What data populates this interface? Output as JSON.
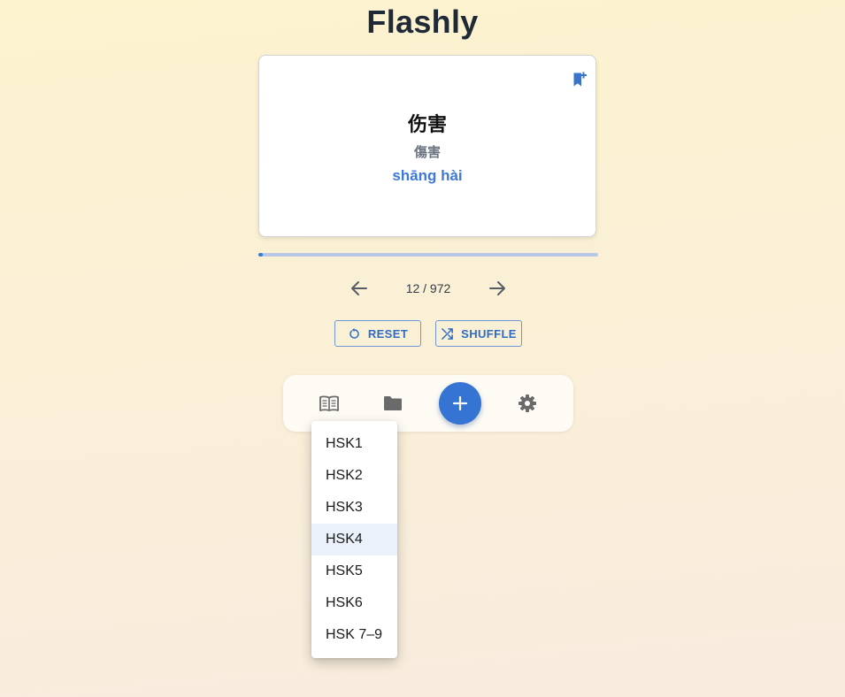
{
  "app": {
    "title": "Flashly"
  },
  "card": {
    "hanzi": "伤害",
    "traditional": "傷害",
    "pinyin": "shāng hài",
    "bookmark_icon": "bookmark-add-icon"
  },
  "progress": {
    "current": 12,
    "total": 972,
    "fraction": 0.0123
  },
  "navigation": {
    "counter": "12 / 972",
    "prev_icon": "arrow-left-icon",
    "next_icon": "arrow-right-icon"
  },
  "actions": {
    "reset_label": "RESET",
    "reset_icon": "reset-icon",
    "shuffle_label": "SHUFFLE",
    "shuffle_icon": "shuffle-icon"
  },
  "toolbar": {
    "items": [
      {
        "icon": "book-icon"
      },
      {
        "icon": "folder-icon"
      },
      {
        "icon": "plus-icon"
      },
      {
        "icon": "gear-icon"
      }
    ]
  },
  "deck_menu": {
    "selected": "HSK4",
    "items": [
      {
        "label": "HSK1"
      },
      {
        "label": "HSK2"
      },
      {
        "label": "HSK3"
      },
      {
        "label": "HSK4"
      },
      {
        "label": "HSK5"
      },
      {
        "label": "HSK6"
      },
      {
        "label": "HSK 7–9"
      }
    ]
  },
  "colors": {
    "accent": "#3674d3",
    "pinyin": "#3d7ad6",
    "progress_track": "#b5c9e7",
    "background_top": "#fcf3cf",
    "background_bottom": "#f8ecdf"
  }
}
